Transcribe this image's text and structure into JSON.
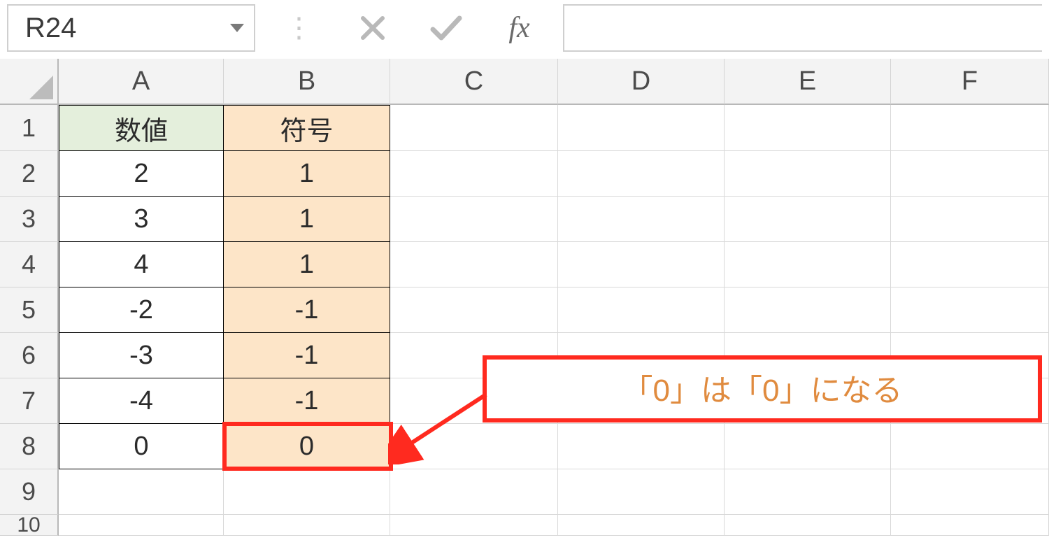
{
  "formula_bar": {
    "name_box_value": "R24",
    "formula_value": "",
    "fx_label": "fx"
  },
  "columns": [
    "A",
    "B",
    "C",
    "D",
    "E",
    "F"
  ],
  "row_numbers": [
    "1",
    "2",
    "3",
    "4",
    "5",
    "6",
    "7",
    "8",
    "9",
    "10"
  ],
  "headers": {
    "A1": "数値",
    "B1": "符号"
  },
  "data": {
    "A": [
      "2",
      "3",
      "4",
      "-2",
      "-3",
      "-4",
      "0"
    ],
    "B": [
      "1",
      "1",
      "1",
      "-1",
      "-1",
      "-1",
      "0"
    ]
  },
  "callout": {
    "text": "「0」は「0」になる"
  }
}
